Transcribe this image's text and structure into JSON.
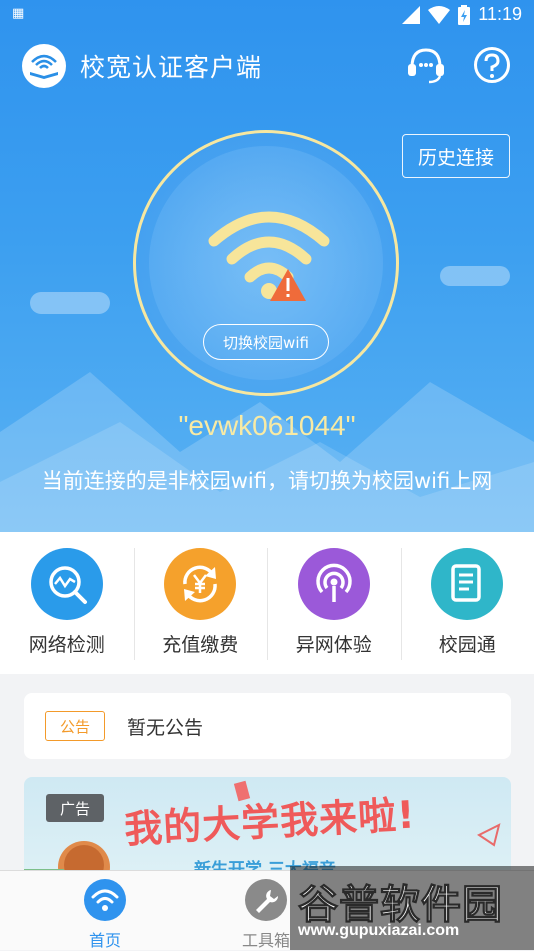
{
  "status_bar": {
    "time": "11:19",
    "left_icon": "qr-code-icon"
  },
  "header": {
    "title": "校宽认证客户端",
    "support_icon": "headset-icon",
    "help_icon": "help-circle-icon"
  },
  "history_button": "历史连接",
  "wifi": {
    "status_icon": "wifi-warning-icon",
    "switch_label": "切换校园wifi",
    "ssid": "\"evwk061044\"",
    "message": "当前连接的是非校园wifi，请切换为校园wifi上网"
  },
  "quick_actions": [
    {
      "label": "网络检测",
      "icon": "network-check-icon",
      "color": "#2a9bea"
    },
    {
      "label": "充值缴费",
      "icon": "yen-recharge-icon",
      "color": "#f5a12c"
    },
    {
      "label": "异网体验",
      "icon": "broadcast-icon",
      "color": "#9b59d9"
    },
    {
      "label": "校园通",
      "icon": "document-icon",
      "color": "#2fb6c9"
    }
  ],
  "notice": {
    "tag": "公告",
    "text": "暂无公告"
  },
  "banner": {
    "tag": "广告",
    "title": "我的大学我来啦!",
    "subtitle": "新生开学 三大福音"
  },
  "nav": [
    {
      "label": "首页",
      "icon": "wifi-home-icon",
      "active": true
    },
    {
      "label": "工具箱",
      "icon": "wrench-icon",
      "active": false
    }
  ],
  "watermark": {
    "title": "谷普软件园",
    "url": "www.gupuxiazai.com"
  },
  "colors": {
    "primary": "#2f93ee",
    "ssid": "#f8eaa4",
    "notice": "#f39a2a",
    "banner_title": "#ef5a5a"
  }
}
